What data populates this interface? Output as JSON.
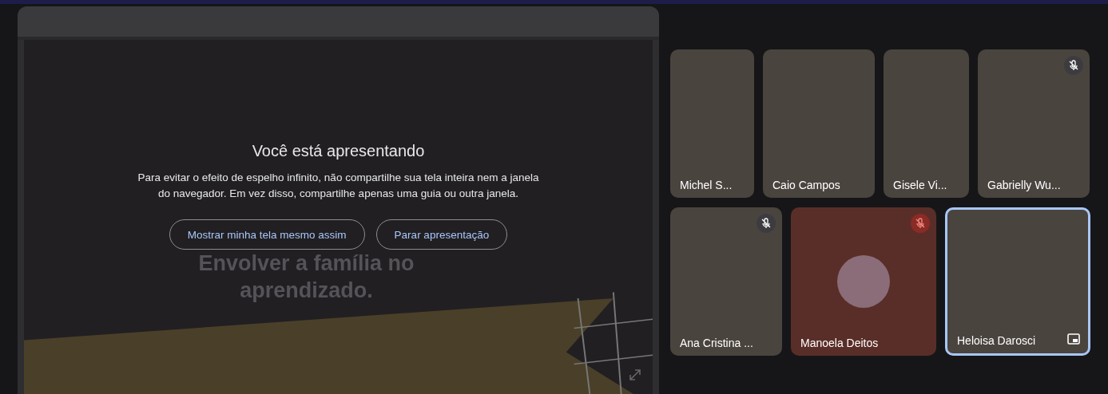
{
  "presentation": {
    "title": "Você está apresentando",
    "message": "Para evitar o efeito de espelho infinito, não compartilhe sua tela inteira nem a janela do navegador. Em vez disso, compartilhe apenas uma guia ou outra janela.",
    "buttons": [
      "Mostrar minha tela mesmo assim",
      "Parar apresentação"
    ],
    "slide_text": "Envolver a família no aprendizado."
  },
  "tile_rows": [
    [
      {
        "name": "Michel S...",
        "kind": "video",
        "muted": false,
        "speaking": false
      },
      {
        "name": "Caio Campos",
        "kind": "video",
        "muted": false,
        "speaking": false
      },
      {
        "name": "Gisele Vi...",
        "kind": "video",
        "muted": false,
        "speaking": false
      },
      {
        "name": "Gabrielly Wu...",
        "kind": "video",
        "muted": true,
        "speaking": false
      }
    ],
    [
      {
        "name": "Ana Cristina ...",
        "kind": "video",
        "muted": true,
        "speaking": false
      },
      {
        "name": "Manoela Deitos",
        "kind": "avatar",
        "muted": true,
        "speaking": false
      },
      {
        "name": "Heloisa Darosci",
        "kind": "video",
        "muted": false,
        "speaking": true
      }
    ]
  ]
}
